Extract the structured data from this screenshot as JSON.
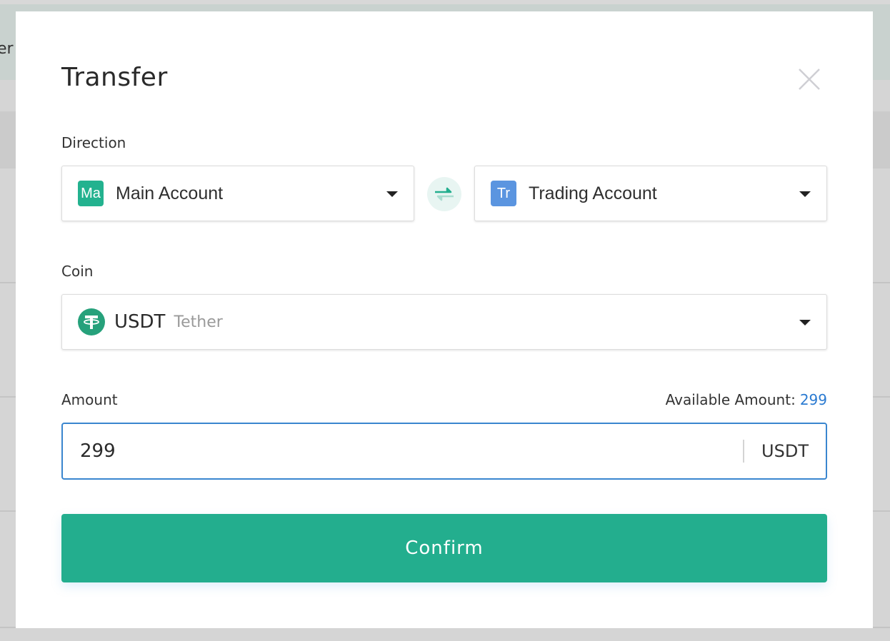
{
  "background": {
    "header_text_fragment": "er"
  },
  "modal": {
    "title": "Transfer",
    "close_icon": "close-icon",
    "direction": {
      "label": "Direction",
      "from": {
        "badge": "Ma",
        "label": "Main Account",
        "badge_color": "#23b28f"
      },
      "to": {
        "badge": "Tr",
        "label": "Trading Account",
        "badge_color": "#5b95e0"
      },
      "swap_icon": "swap-arrows-icon"
    },
    "coin": {
      "label": "Coin",
      "symbol": "USDT",
      "name": "Tether",
      "icon": "tether-icon",
      "icon_color": "#26a17b"
    },
    "amount": {
      "label": "Amount",
      "available_label": "Available Amount:",
      "available_value": "299",
      "value": "299",
      "unit": "USDT"
    },
    "confirm_label": "Confirm"
  },
  "colors": {
    "accent": "#23ae8e",
    "link": "#2a7ad1",
    "focus_border": "#3a86cf"
  }
}
